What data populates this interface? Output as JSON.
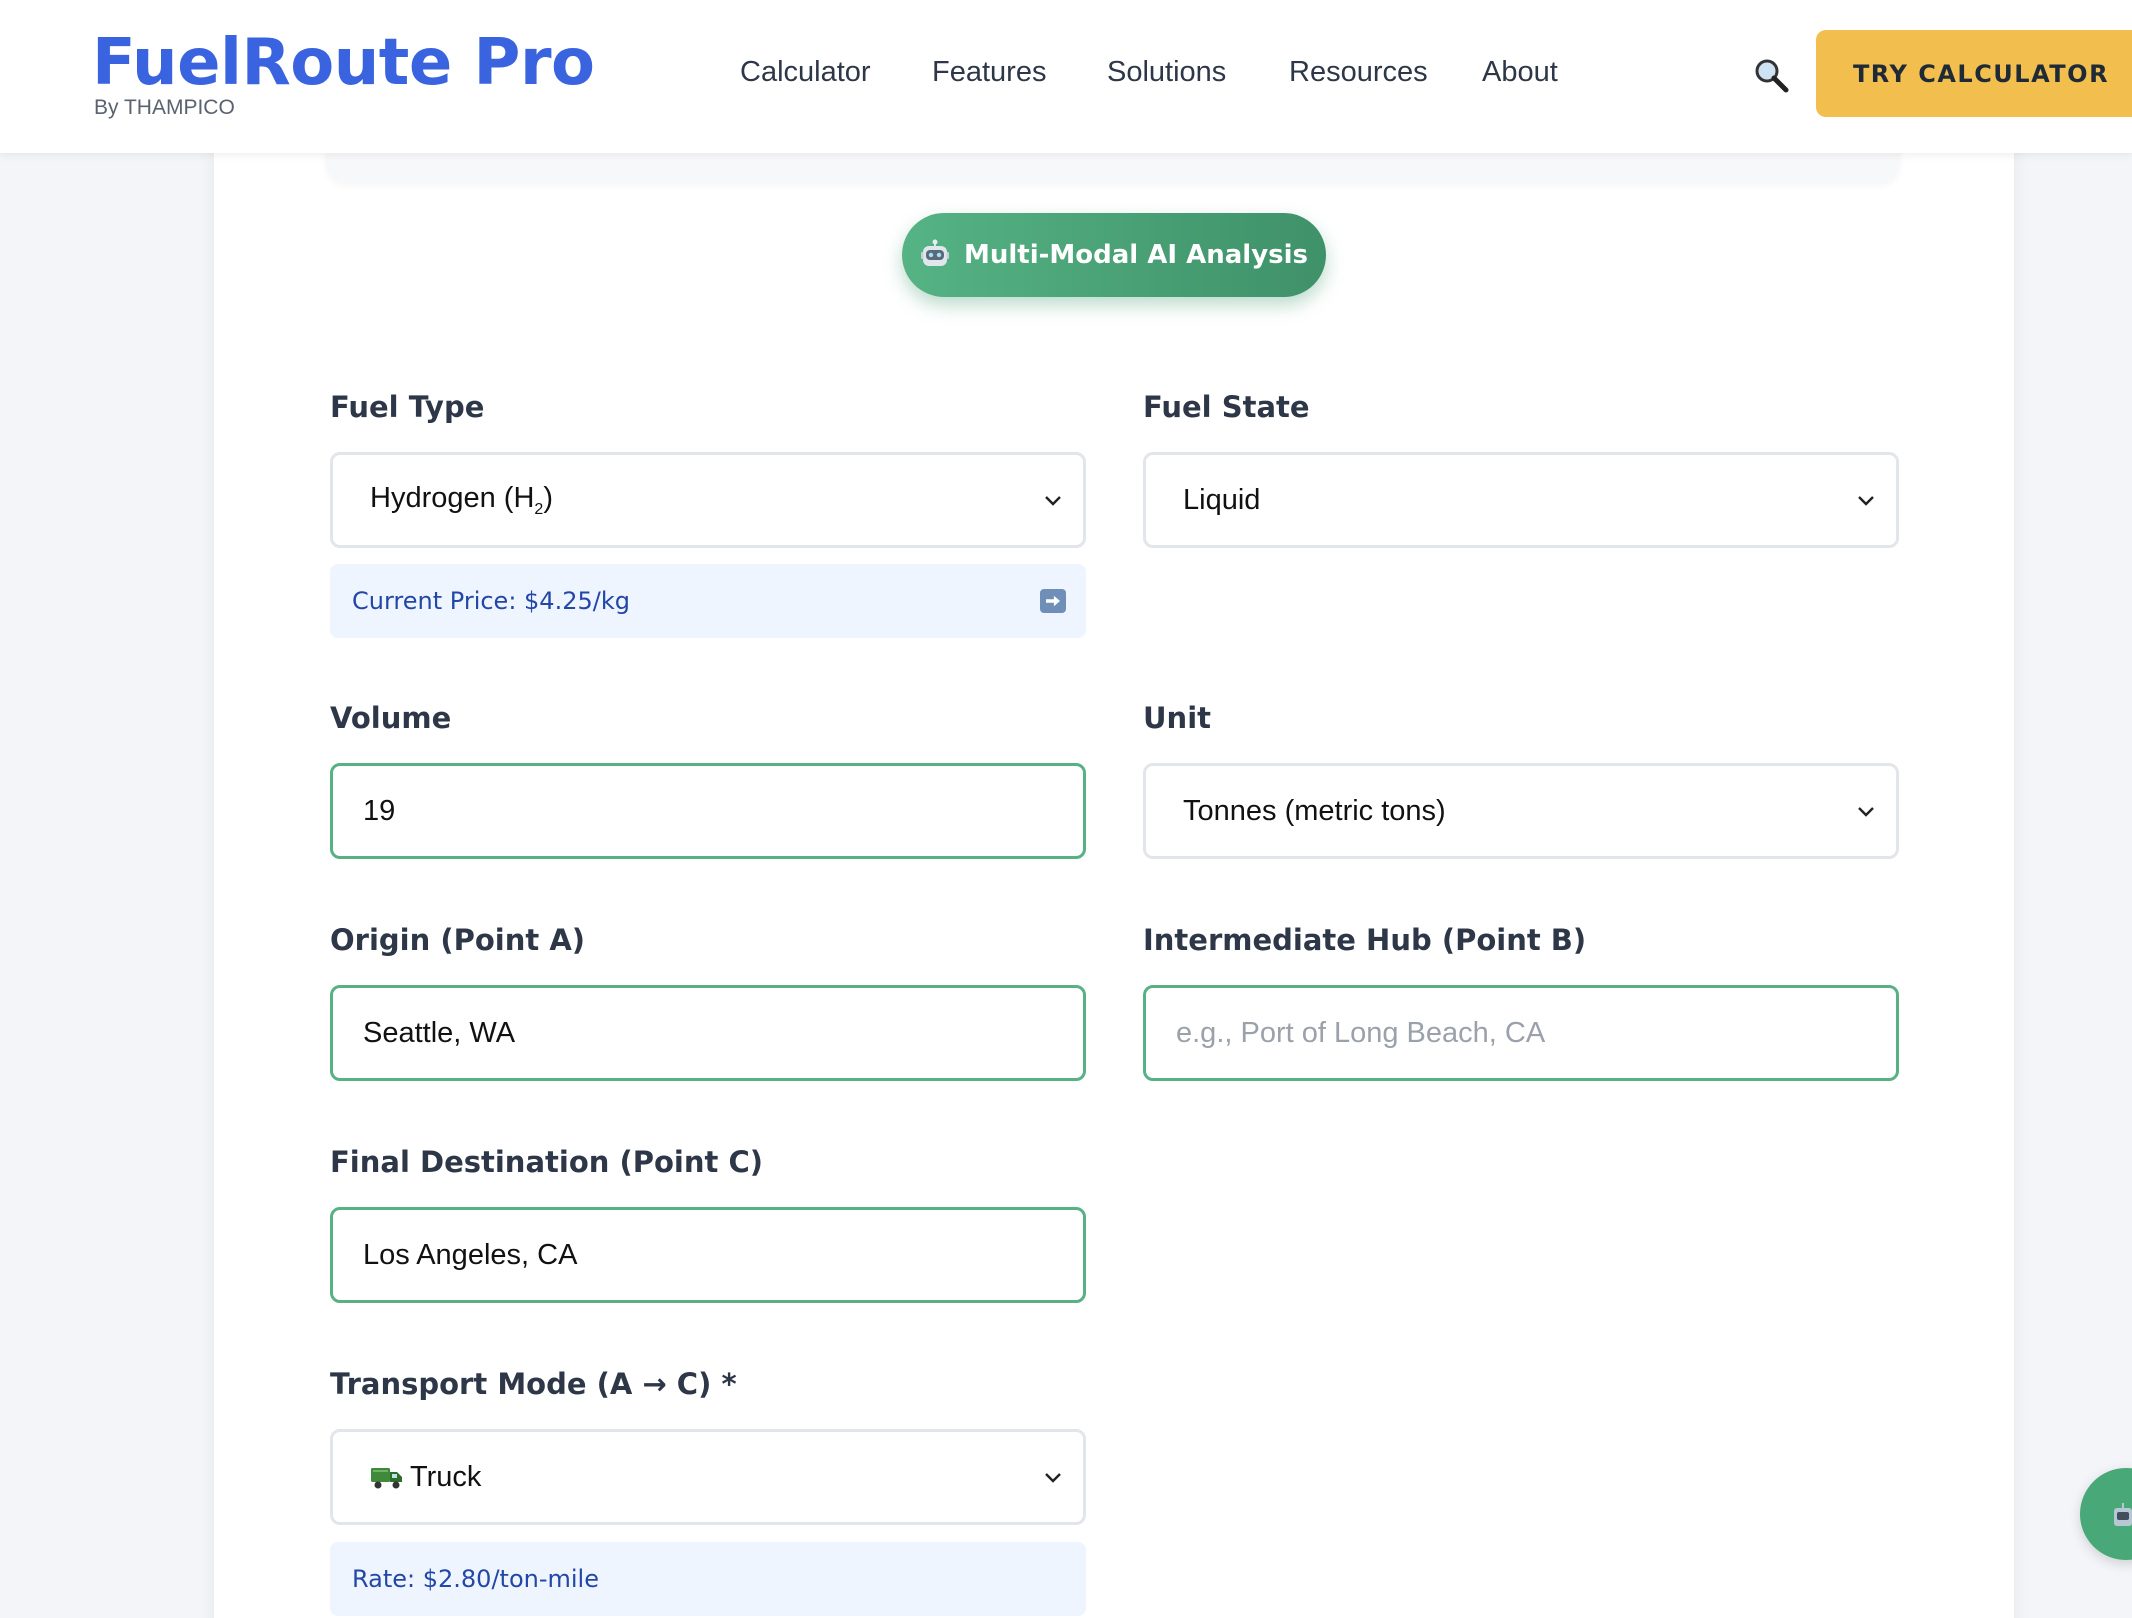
{
  "header": {
    "brand_title": "FuelRoute Pro",
    "brand_subtitle": "By THAMPICO",
    "nav": [
      "Calculator",
      "Features",
      "Solutions",
      "Resources",
      "About"
    ],
    "cta_label": "TRY CALCULATOR"
  },
  "ai_badge": {
    "label": "Multi-Modal AI Analysis"
  },
  "form": {
    "fuel_type": {
      "label": "Fuel Type",
      "value_main": "Hydrogen (H",
      "value_sub": "2",
      "value_end": ")"
    },
    "fuel_price": {
      "text": "Current Price: $4.25/kg"
    },
    "fuel_state": {
      "label": "Fuel State",
      "value": "Liquid"
    },
    "volume": {
      "label": "Volume",
      "value": "19"
    },
    "unit": {
      "label": "Unit",
      "value": "Tonnes (metric tons)"
    },
    "origin": {
      "label": "Origin (Point A)",
      "value": "Seattle, WA"
    },
    "hub": {
      "label": "Intermediate Hub (Point B)",
      "placeholder": "e.g., Port of Long Beach, CA"
    },
    "destination": {
      "label": "Final Destination (Point C)",
      "value": "Los Angeles, CA"
    },
    "transport_mode": {
      "label": "Transport Mode (A → C) *",
      "value": "Truck"
    },
    "rate": {
      "text": "Rate: $2.80/ton-mile"
    }
  },
  "colors": {
    "brand_blue": "#3a63e0",
    "cta_yellow": "#f2be4d",
    "accent_green": "#57b185",
    "note_bg": "#eef5ff",
    "note_text": "#2347a6"
  },
  "icons": {
    "search": "search-icon",
    "robot": "robot-icon",
    "arrow_right": "arrow-right-icon",
    "truck": "truck-icon",
    "chevron": "chevron-down-icon",
    "chat": "chat-icon"
  }
}
